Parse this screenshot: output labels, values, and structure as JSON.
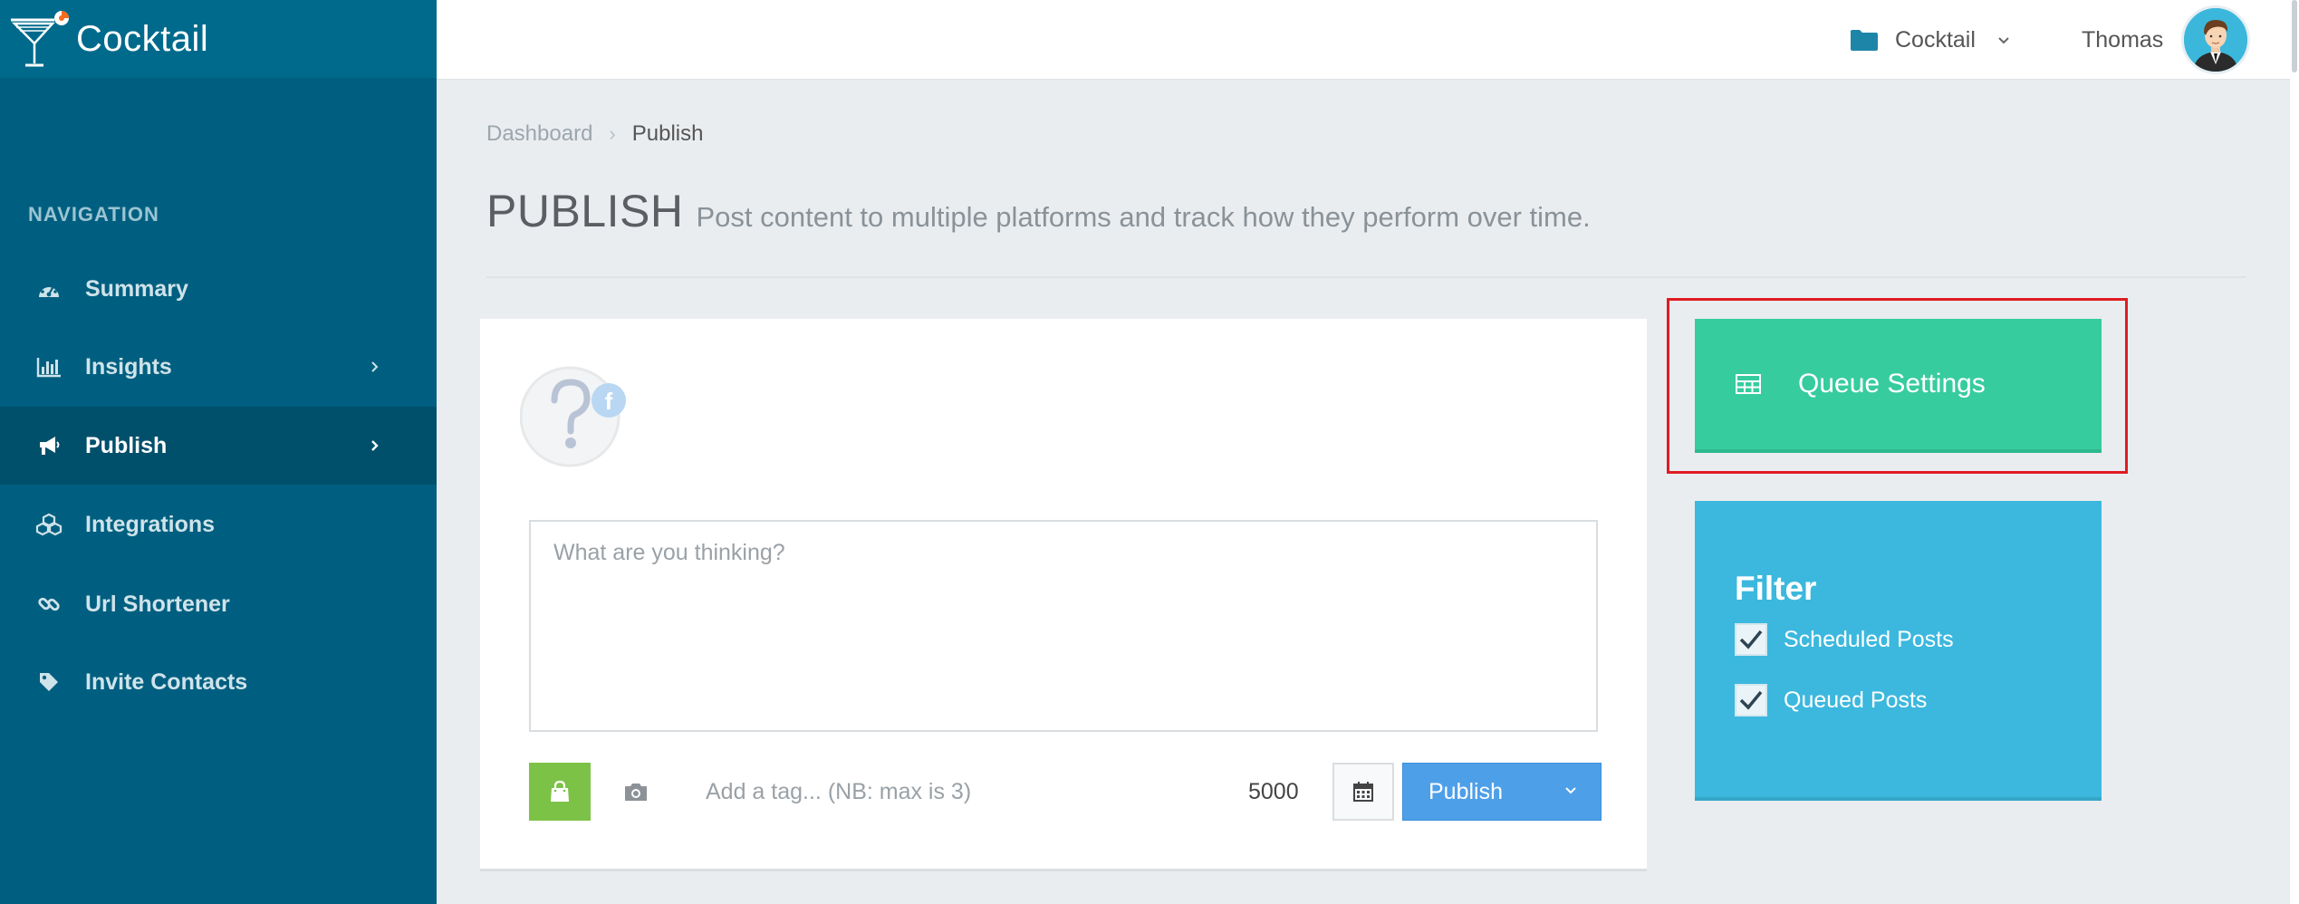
{
  "brand": {
    "name": "Cocktail"
  },
  "sidebar": {
    "header": "NAVIGATION",
    "items": [
      {
        "label": "Summary",
        "icon": "dashboard-icon",
        "has_arrow": false,
        "active": false
      },
      {
        "label": "Insights",
        "icon": "bar-chart-icon",
        "has_arrow": true,
        "active": false
      },
      {
        "label": "Publish",
        "icon": "megaphone-icon",
        "has_arrow": true,
        "active": true
      },
      {
        "label": "Integrations",
        "icon": "cubes-icon",
        "has_arrow": false,
        "active": false
      },
      {
        "label": "Url Shortener",
        "icon": "link-icon",
        "has_arrow": false,
        "active": false
      },
      {
        "label": "Invite Contacts",
        "icon": "tag-icon",
        "has_arrow": false,
        "active": false
      }
    ]
  },
  "topbar": {
    "workspace": "Cocktail",
    "user_name": "Thomas"
  },
  "breadcrumb": {
    "items": [
      "Dashboard",
      "Publish"
    ]
  },
  "page": {
    "title": "PUBLISH",
    "subtitle": "Post content to multiple platforms and track how they perform over time."
  },
  "composer": {
    "placeholder": "What are you thinking?",
    "tag_placeholder": "Add a tag... (NB: max is 3)",
    "char_count": "5000",
    "publish_label": "Publish"
  },
  "queue": {
    "label": "Queue Settings"
  },
  "filter": {
    "title": "Filter",
    "options": [
      {
        "label": "Scheduled Posts",
        "checked": true
      },
      {
        "label": "Queued Posts",
        "checked": true
      }
    ]
  },
  "colors": {
    "sidebar": "#005f80",
    "sidebar_active": "#00506c",
    "queue_green": "#37cc9e",
    "filter_blue": "#3cb8de",
    "publish_blue": "#4d9fe8",
    "media_green": "#7cc246",
    "highlight_red": "#e01b22"
  }
}
